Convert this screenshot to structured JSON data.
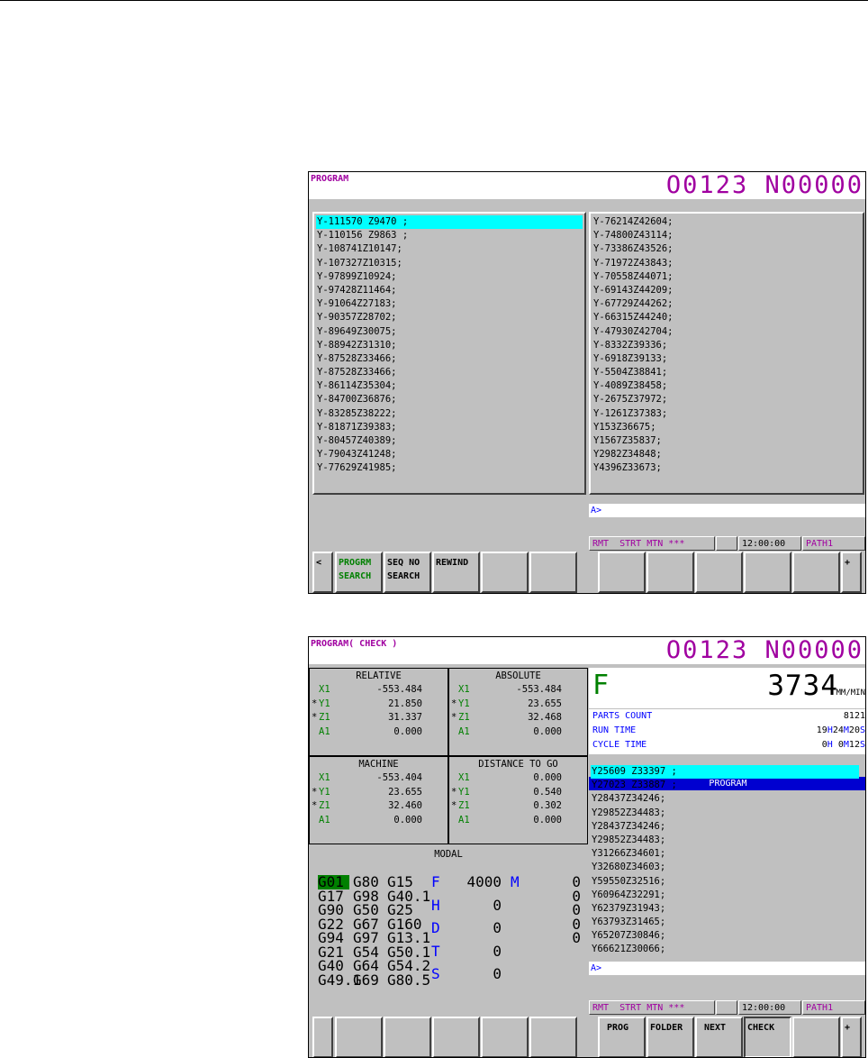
{
  "screen1": {
    "title": "PROGRAM",
    "program_number": "O0123 N00000",
    "left_lines": [
      "Y-111570 Z9470 ;",
      "Y-110156 Z9863 ;",
      "Y-108741Z10147;",
      "Y-107327Z10315;",
      "Y-97899Z10924;",
      "Y-97428Z11464;",
      "Y-91064Z27183;",
      "Y-90357Z28702;",
      "Y-89649Z30075;",
      "Y-88942Z31310;",
      "Y-87528Z33466;",
      "Y-87528Z33466;",
      "Y-86114Z35304;",
      "Y-84700Z36876;",
      "Y-83285Z38222;",
      "Y-81871Z39383;",
      "Y-80457Z40389;",
      "Y-79043Z41248;",
      "Y-77629Z41985;"
    ],
    "right_lines": [
      "Y-76214Z42604;",
      "Y-74800Z43114;",
      "Y-73386Z43526;",
      "Y-71972Z43843;",
      "Y-70558Z44071;",
      "Y-69143Z44209;",
      "Y-67729Z44262;",
      "Y-66315Z44240;",
      "Y-47930Z42704;",
      "Y-8332Z39336;",
      "Y-6918Z39133;",
      "Y-5504Z38841;",
      "Y-4089Z38458;",
      "Y-2675Z37972;",
      "Y-1261Z37383;",
      "Y153Z36675;",
      "Y1567Z35837;",
      "Y2982Z34848;",
      "Y4396Z33673;"
    ],
    "input_prompt": "A>",
    "status": {
      "mode": "RMT  STRT MTN ***",
      "time": "12:00:00",
      "path": "PATH1"
    },
    "softkeys": {
      "back": "<",
      "k1": "PROGRM\nSEARCH",
      "k2": "SEQ NO\nSEARCH",
      "k3": "REWIND",
      "k4": "",
      "k5": "",
      "k6": "",
      "k7": "",
      "k8": "",
      "k9": "",
      "k10": "",
      "next": "+"
    }
  },
  "screen2": {
    "title": "PROGRAM( CHECK )",
    "program_number": "O0123 N00000",
    "relative": {
      "title": "RELATIVE",
      "rows": [
        {
          "star": "",
          "axis": "X1",
          "value": "-553.484"
        },
        {
          "star": "*",
          "axis": "Y1",
          "value": "21.850"
        },
        {
          "star": "*",
          "axis": "Z1",
          "value": "31.337"
        },
        {
          "star": "",
          "axis": "A1",
          "value": "0.000"
        }
      ]
    },
    "absolute": {
      "title": "ABSOLUTE",
      "rows": [
        {
          "star": "",
          "axis": "X1",
          "value": "-553.484"
        },
        {
          "star": "*",
          "axis": "Y1",
          "value": "23.655"
        },
        {
          "star": "*",
          "axis": "Z1",
          "value": "32.468"
        },
        {
          "star": "",
          "axis": "A1",
          "value": "0.000"
        }
      ]
    },
    "machine": {
      "title": "MACHINE",
      "rows": [
        {
          "star": "",
          "axis": "X1",
          "value": "-553.404"
        },
        {
          "star": "*",
          "axis": "Y1",
          "value": "23.655"
        },
        {
          "star": "*",
          "axis": "Z1",
          "value": "32.460"
        },
        {
          "star": "",
          "axis": "A1",
          "value": "0.000"
        }
      ]
    },
    "distance": {
      "title": "DISTANCE TO GO",
      "rows": [
        {
          "star": "",
          "axis": "X1",
          "value": "0.000"
        },
        {
          "star": "*",
          "axis": "Y1",
          "value": "0.540"
        },
        {
          "star": "*",
          "axis": "Z1",
          "value": "0.302"
        },
        {
          "star": "",
          "axis": "A1",
          "value": "0.000"
        }
      ]
    },
    "modal": {
      "title": "MODAL",
      "gcodes": [
        [
          "G01",
          "G80",
          "G15"
        ],
        [
          "G17",
          "G98",
          "G40.1"
        ],
        [
          "G90",
          "G50",
          "G25"
        ],
        [
          "G22",
          "G67",
          "G160"
        ],
        [
          "G94",
          "G97",
          "G13.1"
        ],
        [
          "G21",
          "G54",
          "G50.1"
        ],
        [
          "G40",
          "G64",
          "G54.2"
        ],
        [
          "G49.1",
          "G69",
          "G80.5"
        ]
      ],
      "params": [
        {
          "label": "F",
          "value": "4000",
          "m_label": "M",
          "m_value": "0"
        },
        {
          "label": "H",
          "value": "0",
          "m_label": "",
          "m_value": "0"
        },
        {
          "label": "D",
          "value": "0",
          "m_label": "",
          "m_value": "0"
        },
        {
          "label": "T",
          "value": "0",
          "m_label": "",
          "m_value": "0"
        },
        {
          "label": "S",
          "value": "0",
          "m_label": "",
          "m_value": ""
        }
      ],
      "extra_zero": "0"
    },
    "feed": {
      "label": "F",
      "value": "3734",
      "unit": "MM/MIN"
    },
    "counts": {
      "parts_label": "PARTS COUNT",
      "parts_value": "8121",
      "run_label": "RUN TIME",
      "run_h": "19",
      "run_m": "24",
      "run_s": "20",
      "cycle_label": "CYCLE TIME",
      "cycle_h": "0",
      "cycle_m": "0",
      "cycle_s": "12",
      "h": "H",
      "m": "M",
      "s": "S"
    },
    "program_header": "PROGRAM",
    "program_lines": [
      "Y25609 Z33397 ;",
      "Y27023 Z33887 ;",
      "Y28437Z34246;",
      "Y29852Z34483;",
      "Y28437Z34246;",
      "Y29852Z34483;",
      "Y31266Z34601;",
      "Y32680Z34603;",
      "Y59550Z32516;",
      "Y60964Z32291;",
      "Y62379Z31943;",
      "Y63793Z31465;",
      "Y65207Z30846;",
      "Y66621Z30066;"
    ],
    "input_prompt": "A>",
    "status": {
      "mode": "RMT  STRT MTN ***",
      "time": "12:00:00",
      "path": "PATH1"
    },
    "softkeys": {
      "k_prog": "PROG",
      "k_folder": "FOLDER",
      "k_next": "NEXT",
      "k_check": "CHECK",
      "next": "+"
    }
  }
}
